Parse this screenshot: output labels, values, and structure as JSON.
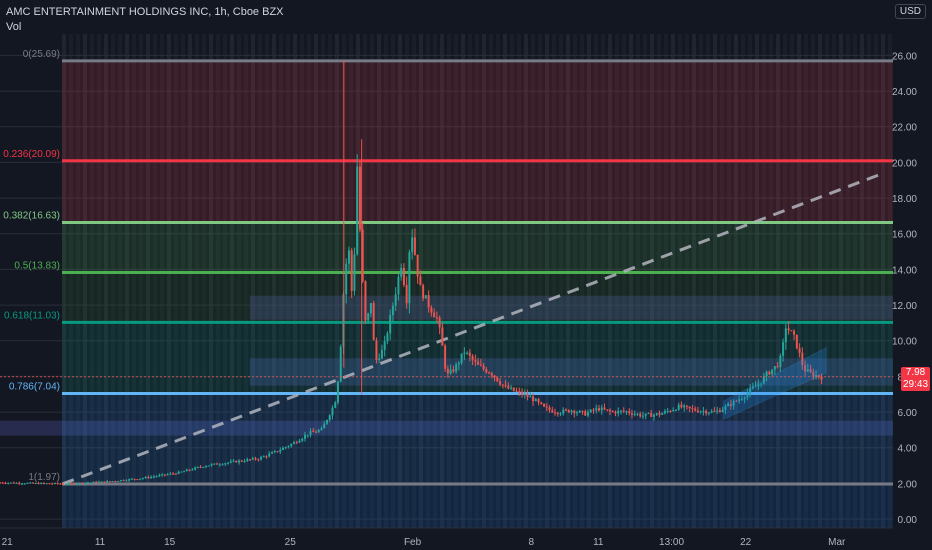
{
  "header": {
    "symbol_title": "AMC ENTERTAINMENT HOLDINGS INC, 1h, Cboe BZX",
    "indicator": "Vol",
    "currency": "USD"
  },
  "price_tag": {
    "price": "7.98",
    "countdown": "29:43"
  },
  "colors": {
    "background": "#131722",
    "up": "#26a69a",
    "down": "#ef5350",
    "fib_0": "#787b86",
    "fib_236": "#f23645",
    "fib_382": "#81c784",
    "fib_5": "#4caf50",
    "fib_618": "#089981",
    "fib_786": "#64b5f6",
    "fib_1": "#787b86",
    "trend_dash": "#b2b5be",
    "zone": "#5b5fbf"
  },
  "chart_data": {
    "type": "candlestick",
    "title": "AMC ENTERTAINMENT HOLDINGS INC, 1h, Cboe BZX",
    "ylim": [
      -0.5,
      27.2
    ],
    "y_ticks": [
      "0.00",
      "2.00",
      "4.00",
      "6.00",
      "8.00",
      "10.00",
      "12.00",
      "14.00",
      "16.00",
      "18.00",
      "20.00",
      "22.00",
      "24.00",
      "26.00"
    ],
    "y_tick_values": [
      0,
      2,
      4,
      6,
      8,
      10,
      12,
      14,
      16,
      18,
      20,
      22,
      24,
      26
    ],
    "x_ticks": [
      "21",
      "11",
      "15",
      "25",
      "Feb",
      "8",
      "11",
      "13:00",
      "22",
      "Mar"
    ],
    "fib_levels": [
      {
        "label": "0(25.69)",
        "value": 25.69,
        "color_key": "fib_0"
      },
      {
        "label": "0.236(20.09)",
        "value": 20.09,
        "color_key": "fib_236"
      },
      {
        "label": "0.382(16.63)",
        "value": 16.63,
        "color_key": "fib_382"
      },
      {
        "label": "0.5(13.83)",
        "value": 13.83,
        "color_key": "fib_5"
      },
      {
        "label": "0.618(11.03)",
        "value": 11.03,
        "color_key": "fib_618"
      },
      {
        "label": "0.786(7.04)",
        "value": 7.04,
        "color_key": "fib_786"
      },
      {
        "label": "1(1.97)",
        "value": 1.97,
        "color_key": "fib_1"
      }
    ],
    "zones": [
      {
        "from": 11.2,
        "to": 12.5,
        "start_index": 0.28
      },
      {
        "from": 7.5,
        "to": 9.0,
        "start_index": 0.28
      },
      {
        "from": 4.7,
        "to": 5.5,
        "start_index": 0.0
      }
    ],
    "trendline": {
      "start": 1.97,
      "end": 19.3
    },
    "last_price": 7.98,
    "price_path": [
      [
        0.0,
        2.05
      ],
      [
        0.04,
        2.0
      ],
      [
        0.08,
        1.98
      ],
      [
        0.12,
        2.1
      ],
      [
        0.16,
        2.3
      ],
      [
        0.2,
        2.6
      ],
      [
        0.23,
        3.0
      ],
      [
        0.26,
        3.2
      ],
      [
        0.29,
        3.4
      ],
      [
        0.31,
        3.8
      ],
      [
        0.33,
        4.3
      ],
      [
        0.345,
        4.8
      ],
      [
        0.36,
        5.0
      ],
      [
        0.375,
        6.5
      ],
      [
        0.38,
        8.4
      ],
      [
        0.385,
        13.0
      ],
      [
        0.39,
        15.5
      ],
      [
        0.395,
        12.0
      ],
      [
        0.4,
        19.8
      ],
      [
        0.405,
        14.0
      ],
      [
        0.41,
        10.5
      ],
      [
        0.415,
        12.5
      ],
      [
        0.42,
        8.8
      ],
      [
        0.43,
        9.6
      ],
      [
        0.44,
        12.0
      ],
      [
        0.45,
        14.5
      ],
      [
        0.455,
        12.0
      ],
      [
        0.46,
        16.5
      ],
      [
        0.47,
        13.0
      ],
      [
        0.48,
        12.0
      ],
      [
        0.49,
        11.2
      ],
      [
        0.495,
        9.8
      ],
      [
        0.5,
        8.0
      ],
      [
        0.51,
        8.5
      ],
      [
        0.52,
        9.4
      ],
      [
        0.535,
        8.6
      ],
      [
        0.55,
        8.2
      ],
      [
        0.565,
        7.4
      ],
      [
        0.58,
        7.1
      ],
      [
        0.595,
        6.8
      ],
      [
        0.61,
        6.2
      ],
      [
        0.625,
        6.0
      ],
      [
        0.64,
        6.1
      ],
      [
        0.655,
        5.9
      ],
      [
        0.67,
        6.2
      ],
      [
        0.685,
        6.0
      ],
      [
        0.7,
        6.05
      ],
      [
        0.72,
        5.8
      ],
      [
        0.74,
        5.9
      ],
      [
        0.76,
        6.3
      ],
      [
        0.78,
        6.1
      ],
      [
        0.8,
        6.0
      ],
      [
        0.81,
        6.2
      ],
      [
        0.82,
        6.5
      ],
      [
        0.83,
        6.8
      ],
      [
        0.84,
        7.2
      ],
      [
        0.85,
        7.6
      ],
      [
        0.86,
        8.2
      ],
      [
        0.87,
        8.6
      ],
      [
        0.875,
        9.1
      ],
      [
        0.88,
        10.8
      ],
      [
        0.885,
        10.5
      ],
      [
        0.89,
        10.1
      ],
      [
        0.895,
        9.3
      ],
      [
        0.9,
        8.4
      ],
      [
        0.91,
        8.1
      ],
      [
        0.92,
        7.98
      ]
    ]
  }
}
